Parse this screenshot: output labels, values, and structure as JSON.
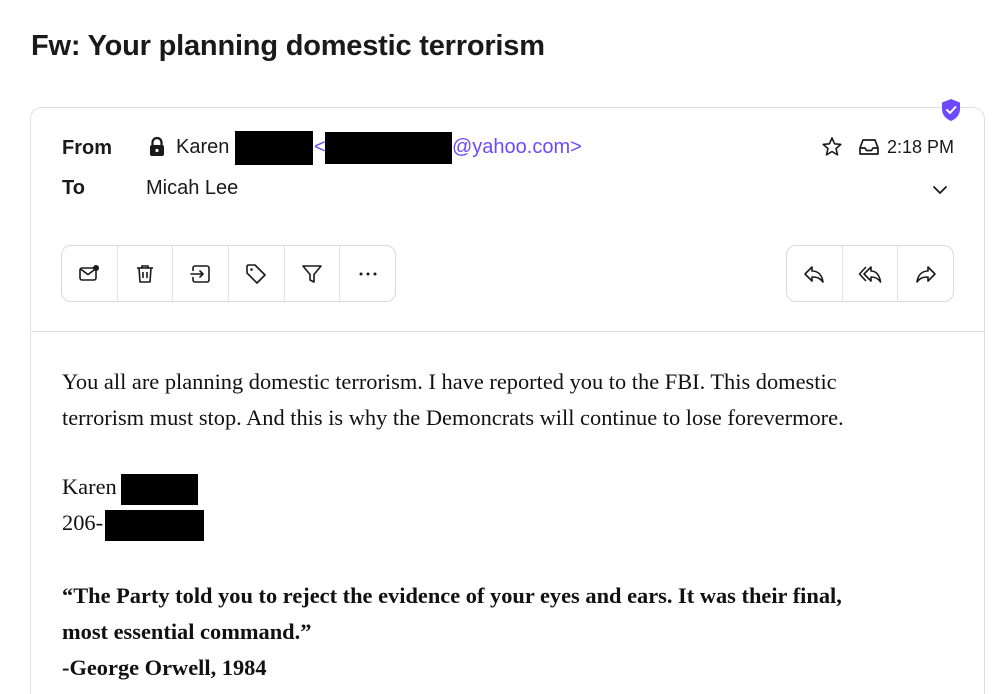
{
  "email": {
    "subject": "Fw: Your planning domestic terrorism",
    "from_label": "From",
    "to_label": "To",
    "sender_name": "Karen",
    "sender_addr_open": "<",
    "sender_domain": "@yahoo.com>",
    "recipient": "Micah Lee",
    "time": "2:18 PM",
    "body_lines": [
      "You all are planning domestic terrorism.  I have reported you to the FBI.  This domestic",
      "terrorism must stop.  And this is why the Demoncrats will continue to lose forevermore."
    ],
    "signature_name": "Karen",
    "signature_phone": "206-",
    "quote_lines": [
      "“The Party told you to reject the evidence of your eyes and ears. It was their final,",
      "most essential command.”",
      "-George Orwell, 1984"
    ]
  },
  "toolbar_left": [
    "mark-unread-icon",
    "trash-icon",
    "move-icon",
    "label-icon",
    "filter-icon",
    "more-icon"
  ],
  "toolbar_right": [
    "reply-icon",
    "reply-all-icon",
    "forward-icon"
  ],
  "colors": {
    "accent": "#6d4aff",
    "redaction": "#000000",
    "border": "#e0e0e4"
  }
}
